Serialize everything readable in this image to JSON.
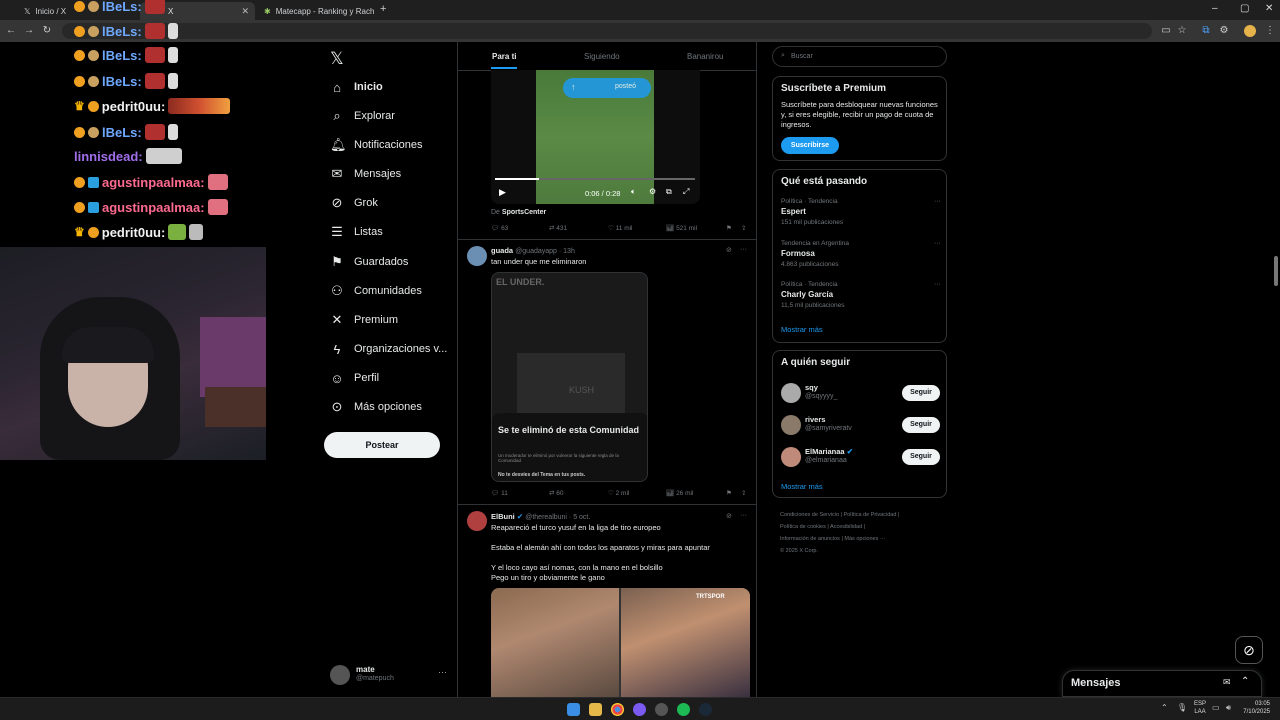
{
  "browser": {
    "tabs": [
      {
        "label": "Inicio / X",
        "active": false
      },
      {
        "label": "X",
        "active": true
      },
      {
        "label": "Matecapp - Ranking y Racha d",
        "active": false
      }
    ]
  },
  "chat": {
    "lines": [
      {
        "user": "lBeLs:",
        "color": "#6ea8ff"
      },
      {
        "user": "lBeLs:",
        "color": "#6ea8ff"
      },
      {
        "user": "lBeLs:",
        "color": "#6ea8ff"
      },
      {
        "user": "lBeLs:",
        "color": "#6ea8ff"
      },
      {
        "user": "pedrit0uu:",
        "color": "#f2f2f2"
      },
      {
        "user": "lBeLs:",
        "color": "#6ea8ff"
      },
      {
        "user": "linnisdead:",
        "color": "#a06ee8"
      },
      {
        "user": "agustinpaalmaa:",
        "color": "#ff6b8f"
      },
      {
        "user": "agustinpaalmaa:",
        "color": "#ff6b8f"
      },
      {
        "user": "pedrit0uu:",
        "color": "#f2f2f2"
      }
    ]
  },
  "sidebar": {
    "items": [
      {
        "label": "Inicio",
        "icon": "home-icon"
      },
      {
        "label": "Explorar",
        "icon": "search-icon"
      },
      {
        "label": "Notificaciones",
        "icon": "bell-icon"
      },
      {
        "label": "Mensajes",
        "icon": "mail-icon"
      },
      {
        "label": "Grok",
        "icon": "grok-icon"
      },
      {
        "label": "Listas",
        "icon": "list-icon"
      },
      {
        "label": "Guardados",
        "icon": "bookmark-icon"
      },
      {
        "label": "Comunidades",
        "icon": "people-icon"
      },
      {
        "label": "Premium",
        "icon": "x-icon"
      },
      {
        "label": "Organizaciones v...",
        "icon": "bolt-icon"
      },
      {
        "label": "Perfil",
        "icon": "person-icon"
      },
      {
        "label": "Más opciones",
        "icon": "more-icon"
      }
    ],
    "post_label": "Postear",
    "account": {
      "name": "mate",
      "handle": "@matepuch"
    }
  },
  "timeline": {
    "tabs": [
      "Para ti",
      "Siguiendo",
      "Bananirou"
    ],
    "video": {
      "pill": "posteó",
      "time": "0:06 / 0:28",
      "source_prefix": "De",
      "source": "SportsCenter"
    },
    "tweet0_actions": [
      "63",
      "431",
      "11 mil",
      "521 mil"
    ],
    "tweet1": {
      "name": "guada",
      "handle": "@guadayapp · 13h",
      "text": "tan under que me eliminaron",
      "img_header": "EL UNDER.",
      "img_brand": "KUSH",
      "img_title": "Se te eliminó de esta Comunidad",
      "img_sub": "Un moderador te eliminó por vulnerar la siguiente regla de la Comunidad",
      "img_rule": "No te desvíes del Tema en tus posts.",
      "actions": [
        "11",
        "60",
        "2 mil",
        "26 mil"
      ]
    },
    "tweet2": {
      "name": "ElBuni",
      "handle": "@therealbuni · 5 oct.",
      "line1": "Reapareció el turco yusuf en la liga de tiro europeo",
      "line2": "Estaba el alemán ahí con todos los aparatos y miras para apuntar",
      "line3": "Y el loco cayo así nomas, con la mano en el bolsillo",
      "line4": "Pego un tiro y obviamente le gano",
      "img_logo": "TRTSPOR"
    }
  },
  "right": {
    "search_placeholder": "Buscar",
    "premium": {
      "title": "Suscríbete a Premium",
      "body": "Suscríbete para desbloquear nuevas funciones y, si eres elegible, recibir un pago de cuota de ingresos.",
      "button": "Suscribirse"
    },
    "trends": {
      "title": "Qué está pasando",
      "items": [
        {
          "meta": "Política · Tendencia",
          "name": "Espert",
          "count": "151 mil publicaciones"
        },
        {
          "meta": "Tendencia en Argentina",
          "name": "Formosa",
          "count": "4.863 publicaciones"
        },
        {
          "meta": "Política · Tendencia",
          "name": "Charly García",
          "count": "11,5 mil publicaciones"
        }
      ],
      "more": "Mostrar más"
    },
    "follow": {
      "title": "A quién seguir",
      "users": [
        {
          "name": "sqy",
          "handle": "@sqyyyy_"
        },
        {
          "name": "rivers",
          "handle": "@samyriveratv"
        },
        {
          "name": "ElMarianaa",
          "handle": "@elmarianaa"
        }
      ],
      "button": "Seguir",
      "more": "Mostrar más"
    },
    "footer": {
      "l1": "Condiciones de Servicio  |  Política de Privacidad  |",
      "l2": "Política de cookies  |  Accesibilidad  |",
      "l3": "Información de anuncios  |  Más opciones ···",
      "l4": "© 2025 X Corp."
    }
  },
  "messages_label": "Mensajes",
  "taskbar": {
    "lang1": "ESP",
    "lang2": "LAA",
    "time": "03:05",
    "date": "7/10/2025"
  }
}
